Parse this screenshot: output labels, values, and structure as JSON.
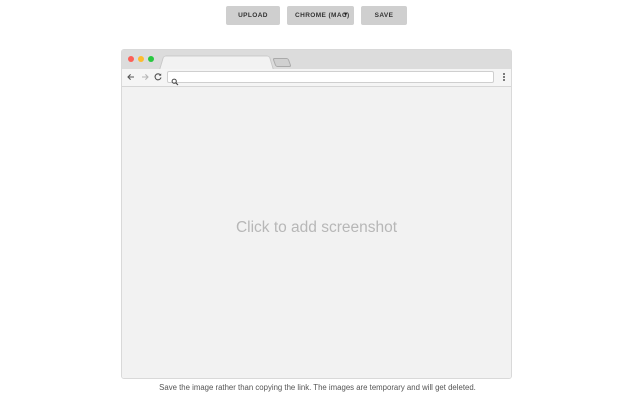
{
  "toolbar": {
    "upload_label": "UPLOAD",
    "browser_select_label": "CHROME (MAC)",
    "save_label": "SAVE"
  },
  "browser": {
    "content_placeholder": "Click to add screenshot"
  },
  "footer": {
    "note": "Save the image rather than copying the link. The images are temporary and will get deleted."
  },
  "icons": {
    "back": "arrow-left-icon",
    "forward": "arrow-right-icon",
    "reload": "reload-icon",
    "search": "search-icon",
    "menu": "kebab-menu-icon",
    "dropdown": "caret-down-icon"
  },
  "colors": {
    "button_bg": "#cfcfcf",
    "window_close": "#fc5f57",
    "window_minimize": "#fdbc2e",
    "window_zoom": "#28c840",
    "content_bg": "#f2f2f2",
    "placeholder_text": "#b7b7b7"
  }
}
